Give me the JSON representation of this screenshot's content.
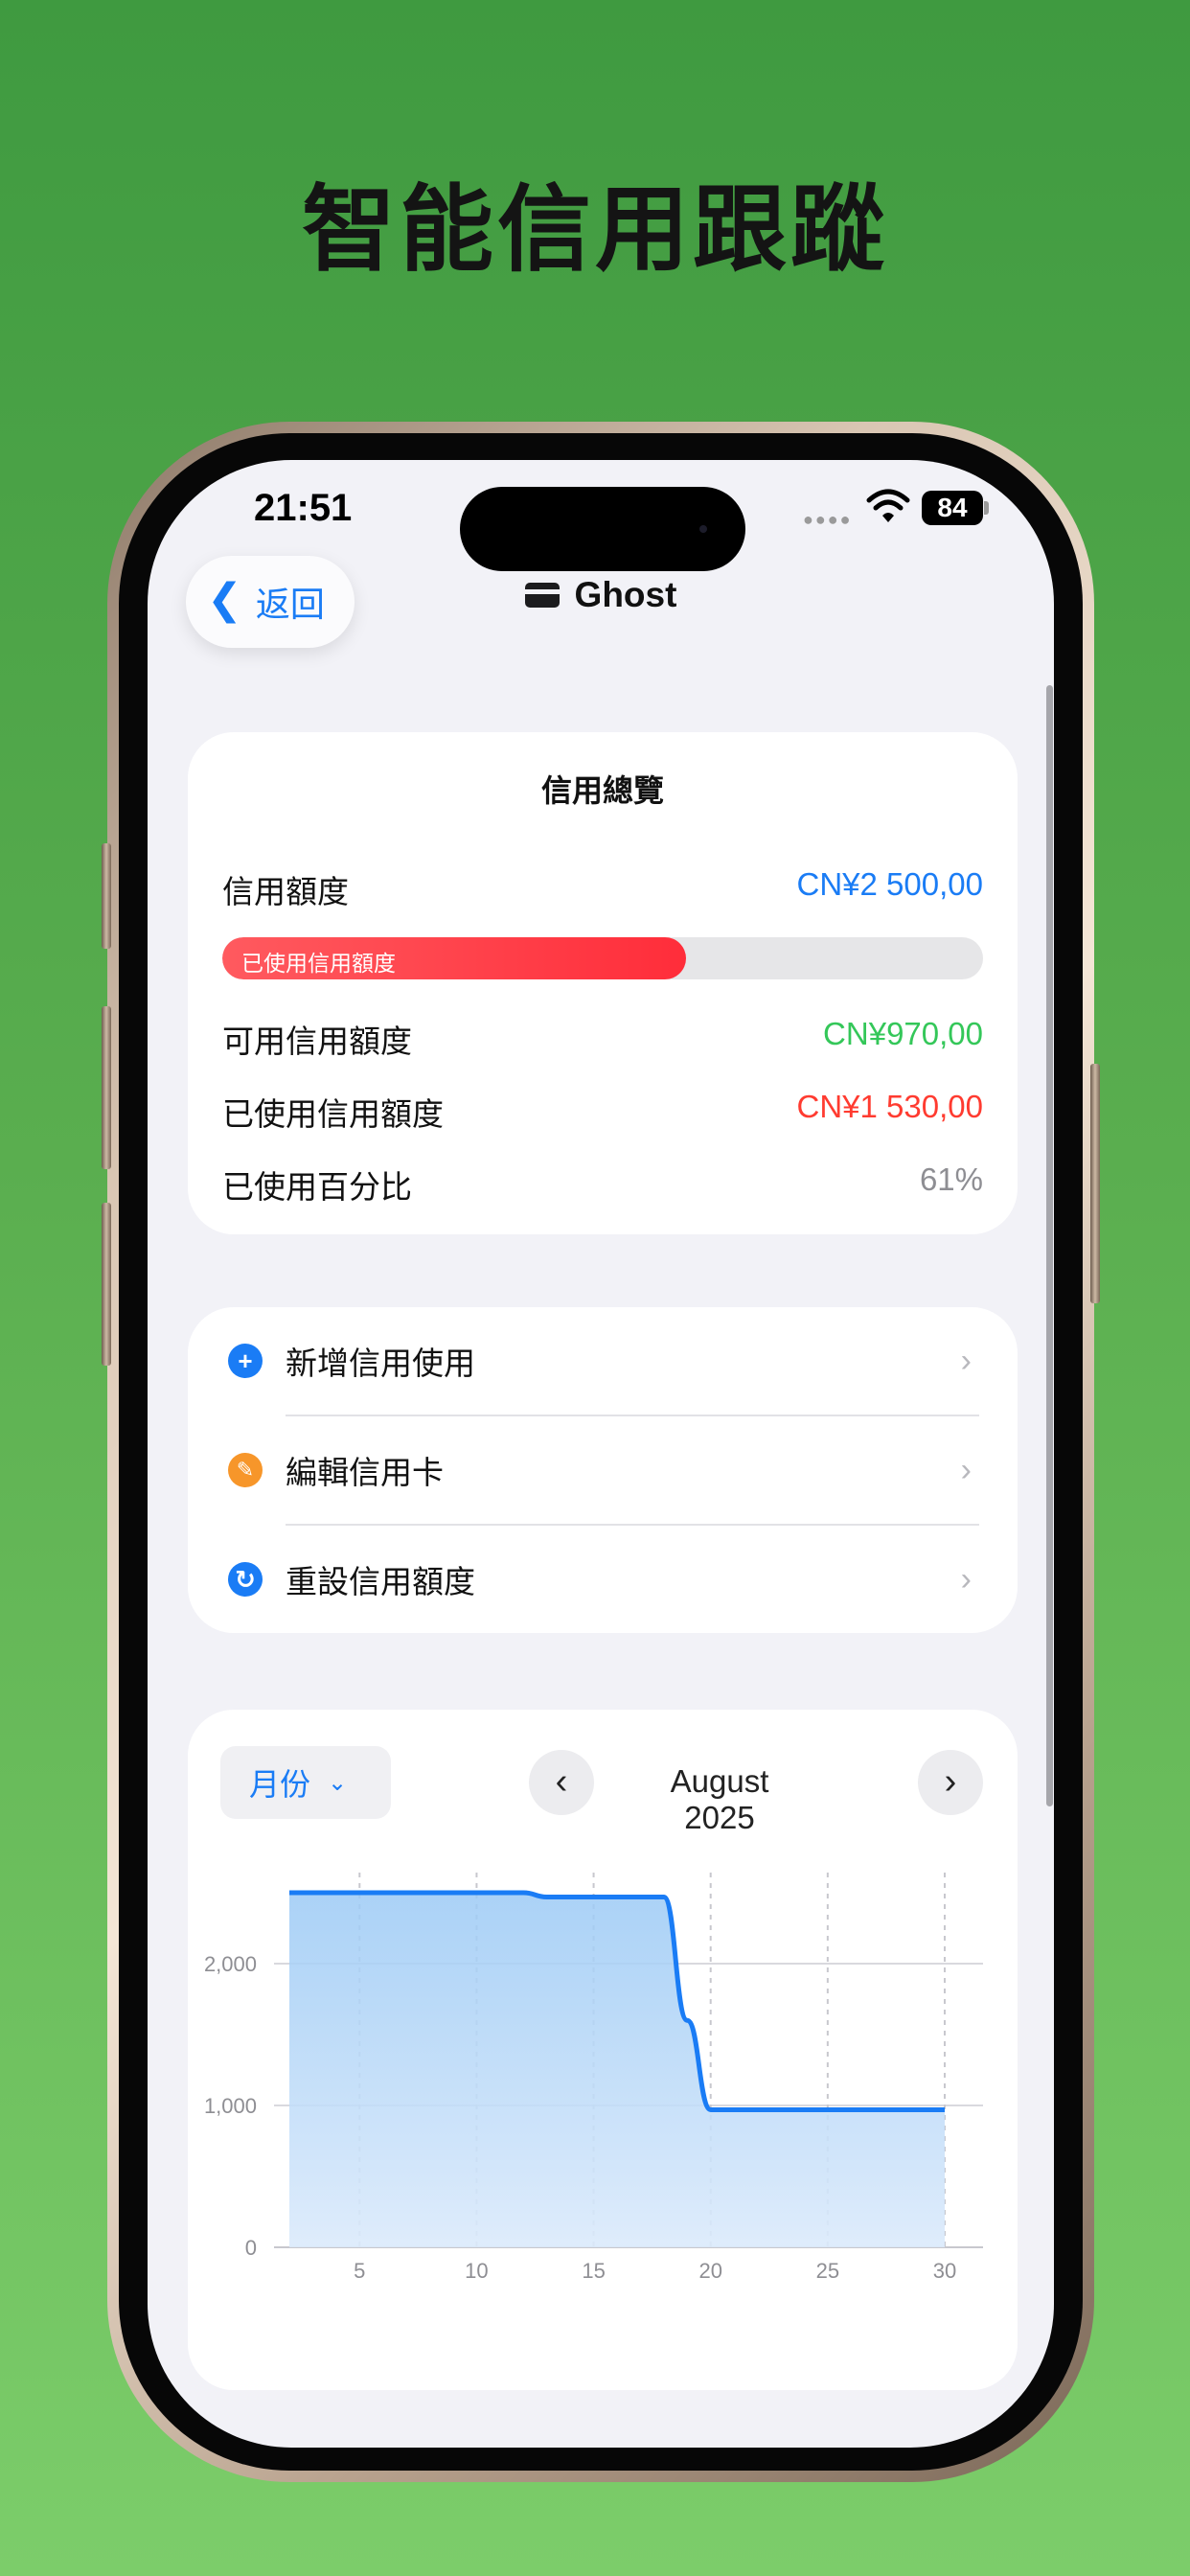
{
  "hero": {
    "title": "智能信用跟蹤"
  },
  "status_bar": {
    "time": "21:51",
    "battery": "84"
  },
  "nav": {
    "back_label": "返回",
    "title": "Ghost"
  },
  "overview": {
    "title": "信用總覽",
    "credit_limit_label": "信用額度",
    "credit_limit_value": "CN¥2 500,00",
    "progress_label": "已使用信用額度",
    "progress_fraction": 0.61,
    "available_label": "可用信用額度",
    "available_value": "CN¥970,00",
    "used_label": "已使用信用額度",
    "used_value": "CN¥1 530,00",
    "percent_label": "已使用百分比",
    "percent_value": "61%"
  },
  "actions": [
    {
      "label": "新增信用使用",
      "icon": "plus-circle-icon",
      "color": "#1a7cf5",
      "glyph": "+"
    },
    {
      "label": "編輯信用卡",
      "icon": "pencil-circle-icon",
      "color": "#f7962a",
      "glyph": "✎"
    },
    {
      "label": "重設信用額度",
      "icon": "reset-circle-icon",
      "color": "#1a7cf5",
      "glyph": "↻"
    }
  ],
  "chart_header": {
    "period": "月份",
    "month": "August 2025"
  },
  "colors": {
    "accent": "#1a7cf5",
    "green": "#34c759",
    "red": "#ff3b30",
    "line": "#1a7cf5"
  },
  "chart_data": {
    "type": "area",
    "x": [
      2,
      3,
      4,
      5,
      6,
      7,
      8,
      9,
      10,
      11,
      12,
      13,
      14,
      15,
      16,
      17,
      18,
      19,
      20,
      21,
      22,
      23,
      24,
      25,
      26,
      27,
      28,
      29,
      30
    ],
    "values": [
      2500,
      2500,
      2500,
      2500,
      2500,
      2500,
      2500,
      2500,
      2500,
      2500,
      2500,
      2470,
      2470,
      2470,
      2470,
      2470,
      2470,
      1600,
      970,
      970,
      970,
      970,
      970,
      970,
      970,
      970,
      970,
      970,
      970
    ],
    "xlim": [
      0,
      31
    ],
    "ylim": [
      0,
      2500
    ],
    "xticks": [
      5,
      10,
      15,
      20,
      25,
      30
    ],
    "yticks": [
      0,
      1000,
      2000
    ],
    "ytick_labels": [
      "0",
      "1,000",
      "2,000"
    ],
    "grid": true
  }
}
